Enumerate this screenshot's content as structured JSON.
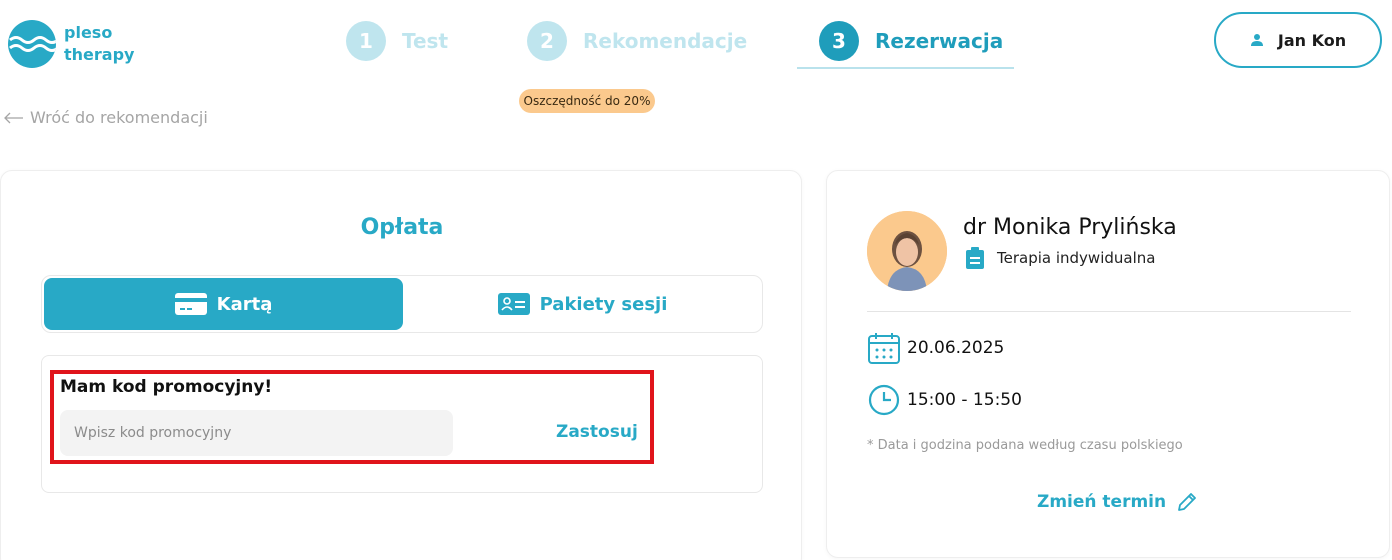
{
  "brand": {
    "line1": "pleso",
    "line2": "therapy",
    "color": "#28a9c6"
  },
  "steps": [
    {
      "number": "1",
      "label": "Test",
      "state": "inactive"
    },
    {
      "number": "2",
      "label": "Rekomendacje",
      "state": "inactive"
    },
    {
      "number": "3",
      "label": "Rezerwacja",
      "state": "active"
    }
  ],
  "user": {
    "name": "Jan Kon",
    "icon": "user-icon"
  },
  "back": {
    "label": "Wróć do rekomendacji",
    "icon": "arrow-left-icon"
  },
  "payment": {
    "title": "Opłata",
    "tabs": [
      {
        "label": "Kartą",
        "icon": "credit-card-icon",
        "selected": true
      },
      {
        "label": "Pakiety sesji",
        "icon": "session-package-icon",
        "selected": false
      }
    ],
    "badge": "Oszczędność do 20%",
    "promo": {
      "title": "Mam kod promocyjny!",
      "placeholder": "Wpisz kod promocyjny",
      "value": "",
      "apply_label": "Zastosuj"
    }
  },
  "appointment": {
    "doctor_name": "dr Monika Prylińska",
    "therapy_type": "Terapia indywidualna",
    "date": "20.06.2025",
    "time": "15:00 - 15:50",
    "note": "* Data i godzina podana według czasu polskiego",
    "change_label": "Zmień termin"
  },
  "colors": {
    "accent": "#28a9c6",
    "badge": "#fbc98d",
    "highlight": "#e0141b",
    "step_inactive": "#bfe5ee"
  }
}
